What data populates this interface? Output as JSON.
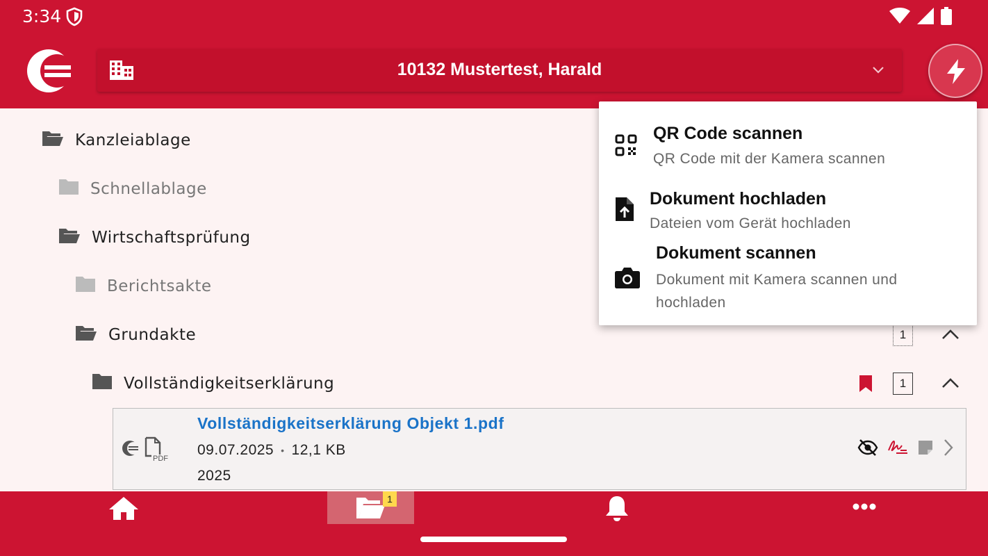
{
  "status_bar": {
    "time": "3:34"
  },
  "header": {
    "client_name": "10132 Mustertest, Harald"
  },
  "tree": [
    {
      "label": "Kanzleiablage",
      "state": "open"
    },
    {
      "label": "Schnellablage",
      "state": "dim"
    },
    {
      "label": "Wirtschaftsprüfung",
      "state": "open"
    },
    {
      "label": "Berichtsakte",
      "state": "dim"
    },
    {
      "label": "Grundakte",
      "state": "open",
      "count": "1"
    },
    {
      "label": "Vollständigkeitserklärung",
      "state": "closed",
      "count": "1",
      "bookmarked": true
    }
  ],
  "document": {
    "title": "Vollständigkeitserklärung Objekt 1.pdf",
    "date": "09.07.2025",
    "size": "12,1 KB",
    "year": "2025",
    "file_type_label": "PDF"
  },
  "quick_menu": {
    "items": [
      {
        "title": "QR Code scannen",
        "subtitle": "QR Code mit der Kamera scannen",
        "icon": "qr-code-icon"
      },
      {
        "title": "Dokument hochladen",
        "subtitle": "Dateien vom Gerät hochladen",
        "icon": "file-upload-icon"
      },
      {
        "title": "Dokument scannen",
        "subtitle": "Dokument mit Kamera scannen und hochladen",
        "icon": "camera-icon"
      }
    ]
  },
  "bottom_nav": {
    "items": [
      "home-icon",
      "folder-icon",
      "bell-icon",
      "more-icon"
    ],
    "active": "folder-icon",
    "folder_badge": "1"
  },
  "colors": {
    "brand": "#cc1432",
    "link": "#1a73c8",
    "badge": "#ffd84d"
  }
}
